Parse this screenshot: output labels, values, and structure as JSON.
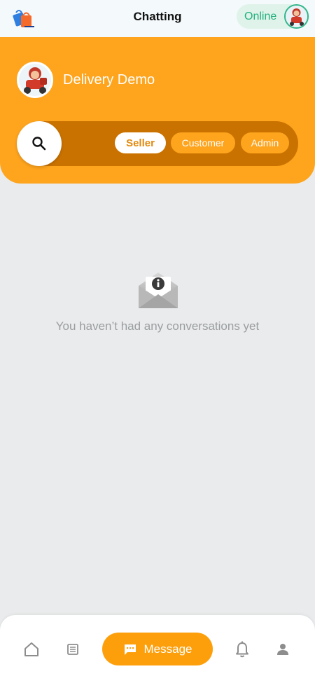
{
  "topbar": {
    "title": "Chatting",
    "status": "Online",
    "logo_icon": "shopping-bags-logo-icon",
    "avatar_icon": "delivery-rider-avatar-icon"
  },
  "header": {
    "store_name": "Delivery Demo",
    "store_avatar_icon": "delivery-rider-avatar-icon",
    "search_icon": "search-icon",
    "filters": [
      "Seller",
      "Customer",
      "Admin"
    ],
    "active_filter": "Seller"
  },
  "empty_state": {
    "icon": "envelope-info-icon",
    "message": "You haven’t had any conversations yet"
  },
  "bottom_nav": {
    "home_icon": "home-icon",
    "orders_icon": "orders-list-icon",
    "message_label": "Message",
    "message_icon": "chat-bubble-icon",
    "notifications_icon": "bell-icon",
    "profile_icon": "profile-icon"
  },
  "colors": {
    "accent": "#fea41d",
    "accent_dark": "#c97200",
    "online": "#23b07d",
    "background": "#e9ebec"
  }
}
